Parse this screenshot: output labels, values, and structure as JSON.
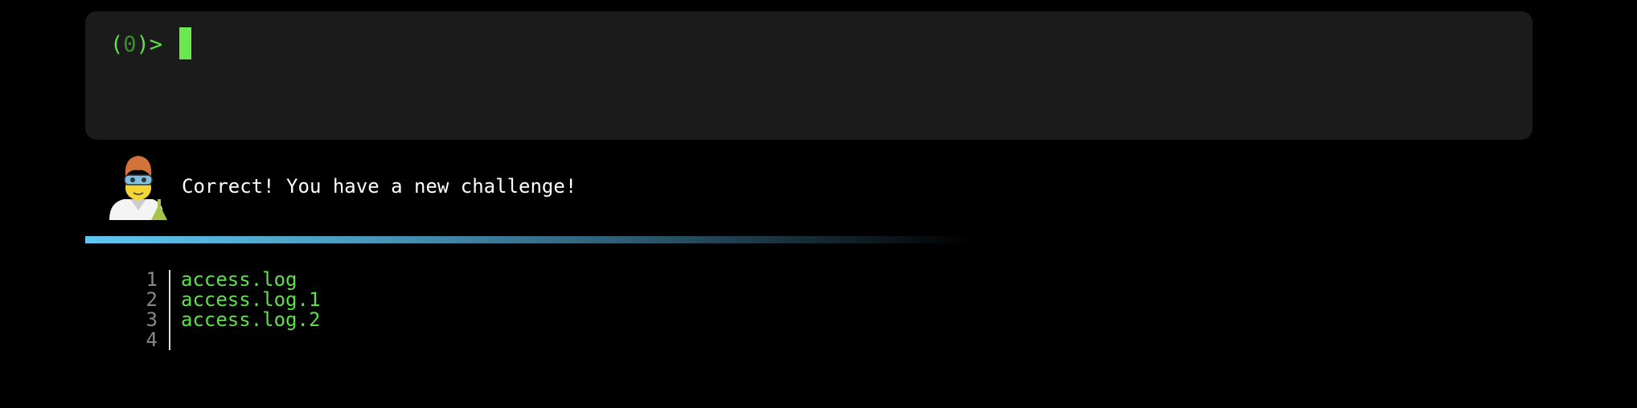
{
  "terminal": {
    "prompt_open": "(",
    "prompt_number": "0",
    "prompt_close": ")>",
    "input_value": ""
  },
  "message": {
    "avatar_icon": "scientist-icon",
    "text": "Correct! You have a new challenge!"
  },
  "colors": {
    "prompt": "#5ee04a",
    "bar_start": "#5ec8f2"
  },
  "listing": {
    "line_numbers": [
      "1",
      "2",
      "3",
      "4"
    ],
    "lines": [
      "access.log",
      "access.log.1",
      "access.log.2",
      ""
    ]
  }
}
